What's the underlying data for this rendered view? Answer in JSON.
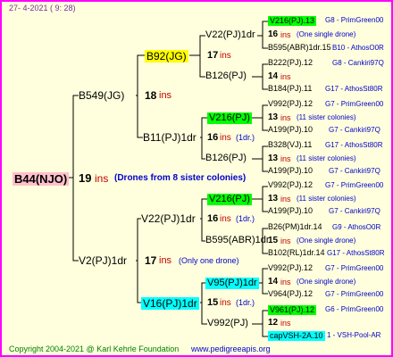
{
  "header": {
    "date": "27-  4-2021  (  9:  28)"
  },
  "footer": {
    "copyright": "Copyright 2004-2021 @ Karl Kehrle Foundation",
    "website": "www.pedigreeapis.org"
  },
  "colors": {
    "border": "#ff00ff",
    "background": "#ffffdd",
    "highlight_green": "#00ff00",
    "highlight_yellow": "#ffff00",
    "highlight_cyan": "#00ffff",
    "root_box": "#ffc0cb"
  },
  "root": {
    "id": "B44(NJO)",
    "ins": "19",
    "ins_label": "ins",
    "note": "(Drones from 8 sister colonies)"
  },
  "gen1": [
    {
      "id": "B549(JG)",
      "ins": "18",
      "ins_label": "ins"
    },
    {
      "id": "V2(PJ)1dr",
      "ins": "17",
      "ins_label": "ins",
      "note": "(Only one drone)"
    }
  ],
  "gen2": [
    {
      "id": "B92(JG)",
      "ins": "17",
      "ins_label": "ins"
    },
    {
      "id": "B11(PJ)1dr",
      "ins": "16",
      "ins_label": "ins",
      "note": "(1dr.)"
    },
    {
      "id": "V22(PJ)1dr",
      "ins": "16",
      "ins_label": "ins",
      "note": "(1dr.)"
    },
    {
      "id": "V16(PJ)1dr",
      "ins": "15",
      "ins_label": "ins",
      "note": "(1dr.)"
    }
  ],
  "gen3": [
    {
      "id": "V22(PJ)1dr",
      "ins": "17",
      "ins_label": "ins"
    },
    {
      "id": "B126(PJ)",
      "ins": "",
      "ins_label": ""
    },
    {
      "id": "V216(PJ)",
      "ins": "16",
      "ins_label": "ins",
      "note": "(1dr.)"
    },
    {
      "id": "B126(PJ)",
      "ins": "",
      "ins_label": ""
    },
    {
      "id": "V216(PJ)",
      "ins": "16",
      "ins_label": "ins",
      "note": "(1dr.)"
    },
    {
      "id": "B595(ABR)1dr",
      "ins": "",
      "ins_label": ""
    },
    {
      "id": "V95(PJ)1dr",
      "ins": "15",
      "ins_label": "ins",
      "note": "(1dr.)"
    },
    {
      "id": "V992(PJ)",
      "ins": "",
      "ins_label": ""
    }
  ],
  "gen4": [
    {
      "id": "V216(PJ).13",
      "line": "G8 - PrimGreen00"
    },
    {
      "ins": "16",
      "ins_label": "ins",
      "note": "(One single drone)"
    },
    {
      "id": "B595(ABR)1dr.15",
      "line": "B10 - AthosO0R"
    },
    {
      "id": "B222(PJ).12",
      "line": "G8 - Cankiri97Q"
    },
    {
      "ins": "14",
      "ins_label": "ins"
    },
    {
      "id": "B184(PJ).11",
      "line": "G17 - AthosSt80R"
    },
    {
      "id": "V992(PJ).12",
      "line": "G7 - PrimGreen00"
    },
    {
      "ins": "13",
      "ins_label": "ins",
      "note": "(11 sister colonies)"
    },
    {
      "id": "A199(PJ).10",
      "line": "G7 - Cankiri97Q"
    },
    {
      "id": "B328(VJ).11",
      "line": "G17 - AthosSt80R"
    },
    {
      "ins": "13",
      "ins_label": "ins",
      "note": "(11 sister colonies)"
    },
    {
      "id": "A199(PJ).10",
      "line": "G7 - Cankiri97Q"
    },
    {
      "id": "V992(PJ).12",
      "line": "G7 - PrimGreen00"
    },
    {
      "ins": "13",
      "ins_label": "ins",
      "note": "(11 sister colonies)"
    },
    {
      "id": "A199(PJ).10",
      "line": "G7 - Cankiri97Q"
    },
    {
      "id": "B26(PM)1dr.14",
      "line": "G9 - AthosO0R"
    },
    {
      "ins": "15",
      "ins_label": "ins",
      "note": "(One single drone)"
    },
    {
      "id": "B102(RL)1dr.14",
      "line": "G17 - AthosSt80R"
    },
    {
      "id": "V992(PJ).12",
      "line": "G7 - PrimGreen00"
    },
    {
      "ins": "14",
      "ins_label": "ins",
      "note": "(One single drone)"
    },
    {
      "id": "V964(PJ).12",
      "line": "G7 - PrimGreen00"
    },
    {
      "id": "V961(PJ).12",
      "line": "G6 - PrimGreen00"
    },
    {
      "ins": "12",
      "ins_label": "ins"
    },
    {
      "id": "capVSH-2A.10",
      "line": "1 - VSH-Pool-AR"
    }
  ]
}
